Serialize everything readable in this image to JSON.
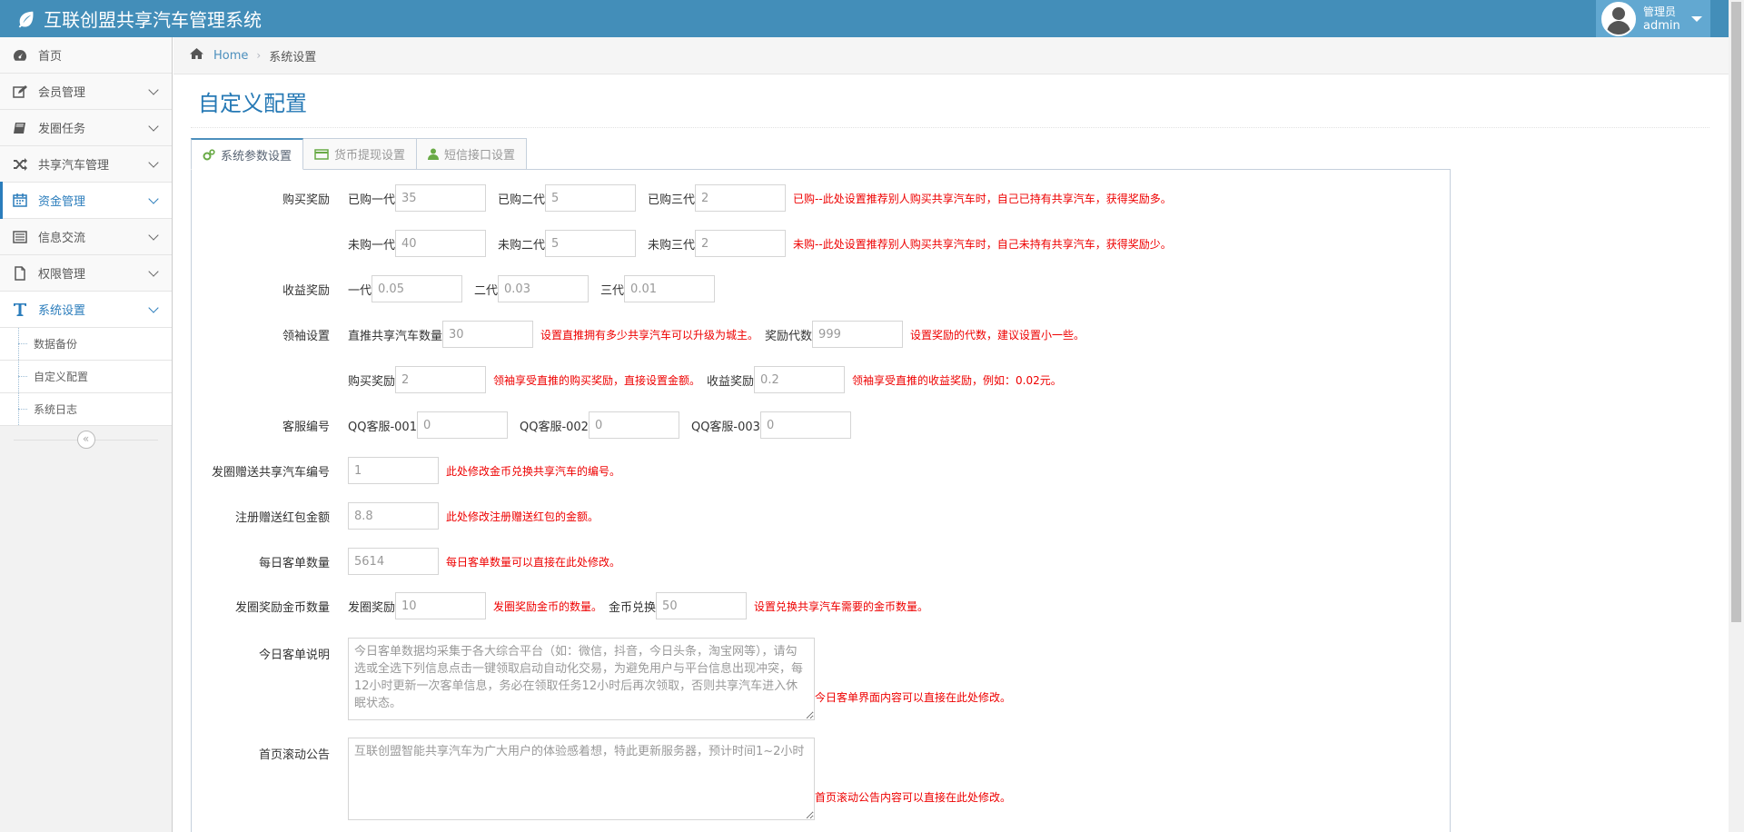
{
  "app": {
    "title": "互联创盟共享汽车管理系统"
  },
  "user": {
    "role": "管理员",
    "name": "admin"
  },
  "sidebar": {
    "items": [
      {
        "label": "首页"
      },
      {
        "label": "会员管理"
      },
      {
        "label": "发圈任务"
      },
      {
        "label": "共享汽车管理"
      },
      {
        "label": "资金管理"
      },
      {
        "label": "信息交流"
      },
      {
        "label": "权限管理"
      },
      {
        "label": "系统设置"
      }
    ],
    "subitems": [
      {
        "label": "数据备份"
      },
      {
        "label": "自定义配置"
      },
      {
        "label": "系统日志"
      }
    ]
  },
  "breadcrumb": {
    "home": "Home",
    "current": "系统设置"
  },
  "page": {
    "title": "自定义配置"
  },
  "tabs": [
    {
      "label": "系统参数设置"
    },
    {
      "label": "货币提现设置"
    },
    {
      "label": "短信接口设置"
    }
  ],
  "form": {
    "purchase_reward": {
      "label": "购买奖励",
      "bought": {
        "l1": "已购一代",
        "v1": "35",
        "l2": "已购二代",
        "v2": "5",
        "l3": "已购三代",
        "v3": "2",
        "hint": "已购--此处设置推荐别人购买共享汽车时，自己已持有共享汽车，获得奖励多。"
      },
      "unbought": {
        "l1": "未购一代",
        "v1": "40",
        "l2": "未购二代",
        "v2": "5",
        "l3": "未购三代",
        "v3": "2",
        "hint": "未购--此处设置推荐别人购买共享汽车时，自己未持有共享汽车，获得奖励少。"
      }
    },
    "income_reward": {
      "label": "收益奖励",
      "l1": "一代",
      "v1": "0.05",
      "l2": "二代",
      "v2": "0.03",
      "l3": "三代",
      "v3": "0.01"
    },
    "leader": {
      "label": "领袖设置",
      "direct_label": "直推共享汽车数量",
      "direct_value": "30",
      "direct_hint": "设置直推拥有多少共享汽车可以升级为城主。",
      "gen_label": "奖励代数",
      "gen_value": "999",
      "gen_hint": "设置奖励的代数，建议设置小一些。",
      "buy_label": "购买奖励",
      "buy_value": "2",
      "buy_hint": "领袖享受直推的购买奖励，直接设置金额。",
      "income_label": "收益奖励",
      "income_value": "0.2",
      "income_hint": "领袖享受直推的收益奖励，例如：0.02元。"
    },
    "service": {
      "label": "客服编号",
      "l1": "QQ客服-001",
      "v1": "0",
      "l2": "QQ客服-002",
      "v2": "0",
      "l3": "QQ客服-003",
      "v3": "0"
    },
    "gift_car": {
      "label": "发圈赠送共享汽车编号",
      "value": "1",
      "hint": "此处修改金币兑换共享汽车的编号。"
    },
    "red_packet": {
      "label": "注册赠送红包金额",
      "value": "8.8",
      "hint": "此处修改注册赠送红包的金额。"
    },
    "daily_orders": {
      "label": "每日客单数量",
      "value": "5614",
      "hint": "每日客单数量可以直接在此处修改。"
    },
    "coin": {
      "label": "发圈奖励金币数量",
      "l1": "发圈奖励",
      "v1": "10",
      "hint1": "发圈奖励金币的数量。",
      "l2": "金币兑换",
      "v2": "50",
      "hint2": "设置兑换共享汽车需要的金币数量。"
    },
    "today_desc": {
      "label": "今日客单说明",
      "value": "今日客单数据均采集于各大综合平台（如：微信，抖音，今日头条，淘宝网等），请勾选或全选下列信息点击一键领取启动自动化交易，为避免用户与平台信息出现冲突，每12小时更新一次客单信息，务必在领取任务12小时后再次领取，否则共享汽车进入休眠状态。",
      "hint": "今日客单界面内容可以直接在此处修改。"
    },
    "scroll_notice": {
      "label": "首页滚动公告",
      "value": "互联创盟智能共享汽车为广大用户的体验感着想，特此更新服务器，预计时间1~2小时",
      "hint": "首页滚动公告内容可以直接在此处修改。"
    }
  },
  "colors": {
    "header": "#438eb9",
    "accent": "#2b7dbc",
    "hint": "#ee0000"
  }
}
